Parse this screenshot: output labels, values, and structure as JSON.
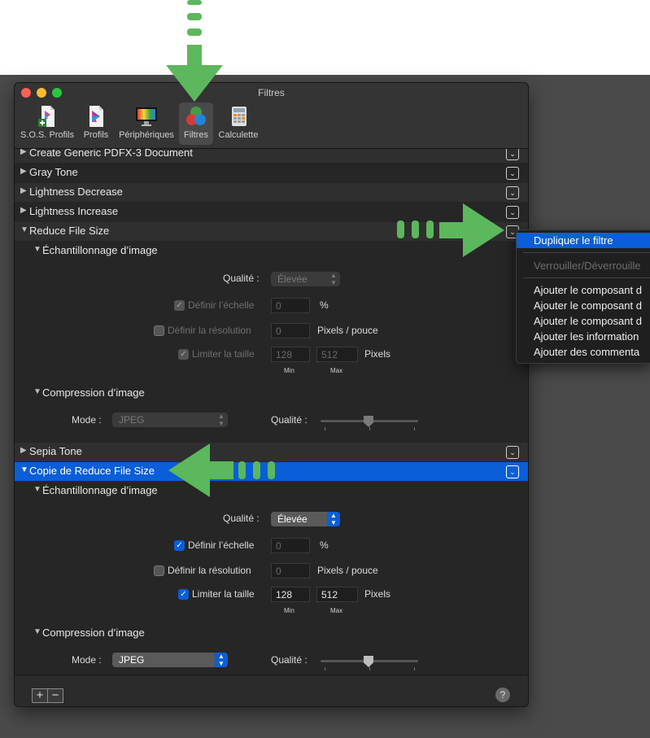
{
  "window": {
    "title": "Filtres"
  },
  "toolbar": {
    "items": [
      {
        "label": "S.O.S. Profils",
        "icon": "sos-profiles-icon"
      },
      {
        "label": "Profils",
        "icon": "profiles-icon"
      },
      {
        "label": "Périphériques",
        "icon": "devices-icon"
      },
      {
        "label": "Filtres",
        "icon": "filters-icon",
        "selected": true
      },
      {
        "label": "Calculette",
        "icon": "calculator-icon"
      }
    ]
  },
  "filters": {
    "collapsed": [
      "Create Generic PDFX-3 Document",
      "Gray Tone",
      "Lightness Decrease",
      "Lightness Increase"
    ],
    "sepia": "Sepia Tone"
  },
  "reduce": {
    "title": "Reduce File Size",
    "sampling_title": "Échantillonnage d’image",
    "quality_label": "Qualité :",
    "quality_value": "Élevée",
    "scale_label": "Définir l’échelle",
    "scale_value": "0",
    "scale_unit": "%",
    "resolution_label": "Définir la résolution",
    "resolution_value": "0",
    "resolution_unit": "Pixels / pouce",
    "limit_label": "Limiter la taille",
    "limit_min": "128",
    "limit_max": "512",
    "limit_unit": "Pixels",
    "min_label": "Min",
    "max_label": "Max",
    "compression_title": "Compression d’image",
    "mode_label": "Mode :",
    "mode_value": "JPEG",
    "comp_quality_label": "Qualité :"
  },
  "copy": {
    "title": "Copie de Reduce File Size",
    "sampling_title": "Échantillonnage d’image",
    "quality_label": "Qualité :",
    "quality_value": "Élevée",
    "scale_label": "Définir l’échelle",
    "scale_value": "0",
    "scale_unit": "%",
    "resolution_label": "Définir la résolution",
    "resolution_value": "0",
    "resolution_unit": "Pixels / pouce",
    "limit_label": "Limiter la taille",
    "limit_min": "128",
    "limit_max": "512",
    "limit_unit": "Pixels",
    "min_label": "Min",
    "max_label": "Max",
    "compression_title": "Compression d’image",
    "mode_label": "Mode :",
    "mode_value": "JPEG",
    "comp_quality_label": "Qualité :"
  },
  "context_menu": {
    "duplicate": "Dupliquer le filtre",
    "lock": "Verrouiller/Déverrouille",
    "add_component_1": "Ajouter le composant d",
    "add_component_2": "Ajouter le composant d",
    "add_component_3": "Ajouter le composant d",
    "add_info": "Ajouter les information",
    "add_comment": "Ajouter des commenta"
  },
  "bottom_bar": {
    "add": "+",
    "remove": "−",
    "help": "?"
  },
  "colors": {
    "accent": "#0a5ed7",
    "annotation_arrow": "#5cb85c"
  }
}
